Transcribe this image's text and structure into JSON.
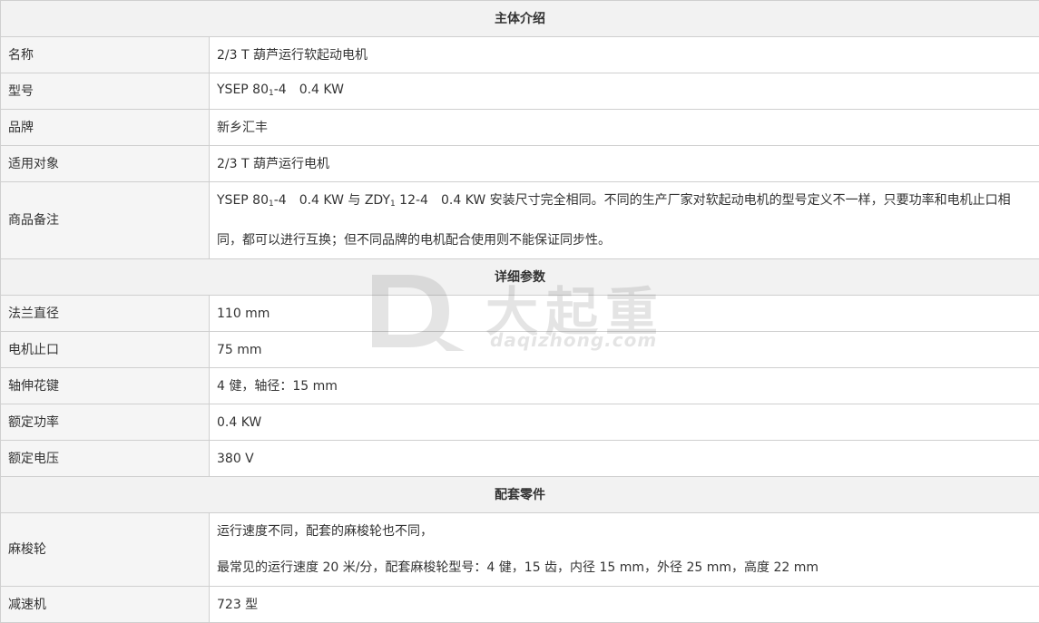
{
  "sections": {
    "main": "主体介绍",
    "detail": "详细参数",
    "parts": "配套零件"
  },
  "main_rows": {
    "name": {
      "label": "名称",
      "value": "2/3 T 葫芦运行软起动电机"
    },
    "model": {
      "label": "型号",
      "value_prefix": "YSEP 80",
      "value_sub": "1",
      "value_suffix": "-4　0.4 KW"
    },
    "brand": {
      "label": "品牌",
      "value": "新乡汇丰"
    },
    "target": {
      "label": "适用对象",
      "value": "2/3 T 葫芦运行电机"
    },
    "remarks": {
      "label": "商品备注",
      "line1_a": "YSEP 80",
      "line1_sub1": "1",
      "line1_b": "-4　0.4 KW  与 ZDY",
      "line1_sub2": "1",
      "line1_c": " 12-4　0.4 KW 安装尺寸完全相同。不同的生产厂家对软起动电机的型号定义不一样，只要功率和电机止口相",
      "line2": "同，都可以进行互换；但不同品牌的电机配合使用则不能保证同步性。"
    }
  },
  "detail_rows": [
    {
      "label": "法兰直径",
      "value": "110 mm"
    },
    {
      "label": "电机止口",
      "value": "75 mm"
    },
    {
      "label": "轴伸花键",
      "value": "4 健，轴径：15 mm"
    },
    {
      "label": "额定功率",
      "value": "0.4 KW"
    },
    {
      "label": "额定电压",
      "value": "380 V"
    }
  ],
  "parts_rows": {
    "wheel": {
      "label": "麻梭轮",
      "line1": "运行速度不同，配套的麻梭轮也不同，",
      "line2": "最常见的运行速度 20 米/分，配套麻梭轮型号：4 健，15 齿，内径 15 mm，外径 25 mm，高度 22 mm"
    },
    "reducer": {
      "label": "减速机",
      "value": "723 型"
    }
  },
  "watermark": {
    "cn": "大起重",
    "en": "daqizhong.com"
  }
}
